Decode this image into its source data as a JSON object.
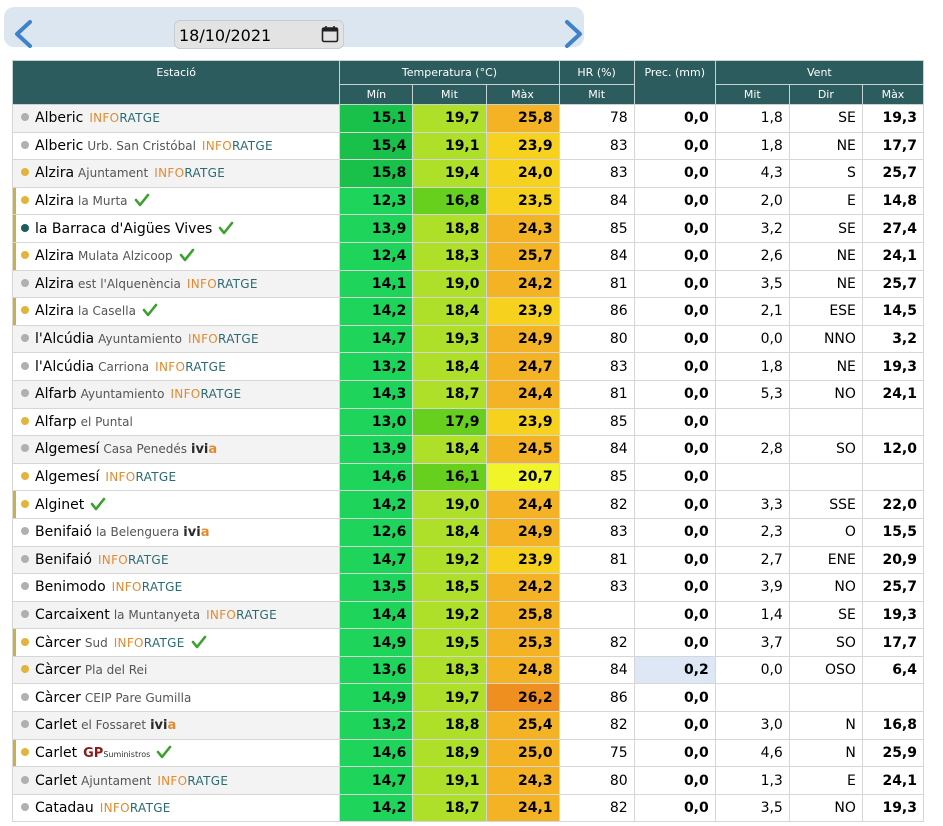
{
  "date": "18/10/2021",
  "headers": {
    "station": "Estació",
    "temperature": "Temperatura (°C)",
    "hr": "HR (%)",
    "prec": "Prec. (mm)",
    "wind": "Vent",
    "min": "Mín",
    "mit": "Mit",
    "max": "Màx",
    "hr_mit": "Mit",
    "wind_mit": "Mit",
    "wind_dir": "Dir",
    "wind_max": "Màx"
  },
  "colors": {
    "header_bg": "#2c5c5e",
    "dot_grey": "#b0b0b0",
    "dot_orange": "#e2b43a",
    "dot_teal": "#1e5b5e",
    "check_green": "#3aa12c",
    "prec_highlight": "#dde7f5"
  },
  "icons": {
    "prev": "chevron-left-icon",
    "next": "chevron-right-icon",
    "calendar": "calendar-icon",
    "validated": "check-icon"
  },
  "rows": [
    {
      "name": "Alberic",
      "sub": "",
      "brand": "inforatge",
      "check": false,
      "dot": "grey",
      "min": "15,1",
      "mit": "19,7",
      "max": "25,8",
      "hr": "78",
      "prec": "0,0",
      "wmit": "1,8",
      "wdir": "SE",
      "wmax": "19,3",
      "cmin": "#19c14a",
      "cmit": "#aee02a",
      "cmax": "#f3b324"
    },
    {
      "name": "Alberic",
      "sub": "Urb. San Cristóbal",
      "brand": "inforatge",
      "check": false,
      "dot": "grey",
      "min": "15,4",
      "mit": "19,1",
      "max": "23,9",
      "hr": "83",
      "prec": "0,0",
      "wmit": "1,8",
      "wdir": "NE",
      "wmax": "17,7",
      "cmin": "#19c14a",
      "cmit": "#aee02a",
      "cmax": "#f6d21f"
    },
    {
      "name": "Alzira",
      "sub": "Ajuntament",
      "brand": "inforatge",
      "check": false,
      "dot": "orange",
      "min": "15,8",
      "mit": "19,4",
      "max": "24,0",
      "hr": "83",
      "prec": "0,0",
      "wmit": "4,3",
      "wdir": "S",
      "wmax": "25,7",
      "cmin": "#19c14a",
      "cmit": "#aee02a",
      "cmax": "#f6d21f"
    },
    {
      "name": "Alzira",
      "sub": "la Murta",
      "brand": "",
      "check": true,
      "dot": "orange",
      "min": "12,3",
      "mit": "16,8",
      "max": "23,5",
      "hr": "84",
      "prec": "0,0",
      "wmit": "2,0",
      "wdir": "E",
      "wmax": "14,8",
      "cmin": "#1ed45a",
      "cmit": "#67cf1d",
      "cmax": "#f6d21f"
    },
    {
      "name": "la Barraca d'Aigües Vives",
      "sub": "",
      "brand": "",
      "check": true,
      "dot": "teal",
      "min": "13,9",
      "mit": "18,8",
      "max": "24,3",
      "hr": "85",
      "prec": "0,0",
      "wmit": "3,2",
      "wdir": "SE",
      "wmax": "27,4",
      "cmin": "#1ed45a",
      "cmit": "#aee02a",
      "cmax": "#f3b324"
    },
    {
      "name": "Alzira",
      "sub": "Mulata Alzicoop",
      "brand": "",
      "check": true,
      "dot": "orange",
      "min": "12,4",
      "mit": "18,3",
      "max": "25,7",
      "hr": "84",
      "prec": "0,0",
      "wmit": "2,6",
      "wdir": "NE",
      "wmax": "24,1",
      "cmin": "#1ed45a",
      "cmit": "#aee02a",
      "cmax": "#f3b324"
    },
    {
      "name": "Alzira",
      "sub": "est l'Alquenència",
      "brand": "inforatge",
      "check": false,
      "dot": "grey",
      "min": "14,1",
      "mit": "19,0",
      "max": "24,2",
      "hr": "81",
      "prec": "0,0",
      "wmit": "3,5",
      "wdir": "NE",
      "wmax": "25,7",
      "cmin": "#1ed45a",
      "cmit": "#aee02a",
      "cmax": "#f3b324"
    },
    {
      "name": "Alzira",
      "sub": "la Casella",
      "brand": "",
      "check": true,
      "dot": "orange",
      "min": "14,2",
      "mit": "18,4",
      "max": "23,9",
      "hr": "86",
      "prec": "0,0",
      "wmit": "2,1",
      "wdir": "ESE",
      "wmax": "14,5",
      "cmin": "#1ed45a",
      "cmit": "#aee02a",
      "cmax": "#f6d21f"
    },
    {
      "name": "l'Alcúdia",
      "sub": "Ayuntamiento",
      "brand": "inforatge",
      "check": false,
      "dot": "grey",
      "min": "14,7",
      "mit": "19,3",
      "max": "24,9",
      "hr": "80",
      "prec": "0,0",
      "wmit": "0,0",
      "wdir": "NNO",
      "wmax": "3,2",
      "cmin": "#1ed45a",
      "cmit": "#aee02a",
      "cmax": "#f3b324"
    },
    {
      "name": "l'Alcúdia",
      "sub": "Carriona",
      "brand": "inforatge",
      "check": false,
      "dot": "grey",
      "min": "13,2",
      "mit": "18,4",
      "max": "24,7",
      "hr": "83",
      "prec": "0,0",
      "wmit": "1,8",
      "wdir": "NE",
      "wmax": "19,3",
      "cmin": "#1ed45a",
      "cmit": "#aee02a",
      "cmax": "#f3b324"
    },
    {
      "name": "Alfarb",
      "sub": "Ayuntamiento",
      "brand": "inforatge",
      "check": false,
      "dot": "grey",
      "min": "14,3",
      "mit": "18,7",
      "max": "24,4",
      "hr": "81",
      "prec": "0,0",
      "wmit": "5,3",
      "wdir": "NO",
      "wmax": "24,1",
      "cmin": "#1ed45a",
      "cmit": "#aee02a",
      "cmax": "#f3b324"
    },
    {
      "name": "Alfarp",
      "sub": "el Puntal",
      "brand": "",
      "check": false,
      "dot": "orange",
      "min": "13,0",
      "mit": "17,9",
      "max": "23,9",
      "hr": "85",
      "prec": "0,0",
      "wmit": "",
      "wdir": "",
      "wmax": "",
      "cmin": "#1ed45a",
      "cmit": "#67cf1d",
      "cmax": "#f6d21f"
    },
    {
      "name": "Algemesí",
      "sub": "Casa Penedés",
      "brand": "ivia",
      "check": false,
      "dot": "grey",
      "min": "13,9",
      "mit": "18,4",
      "max": "24,5",
      "hr": "84",
      "prec": "0,0",
      "wmit": "2,8",
      "wdir": "SO",
      "wmax": "12,0",
      "cmin": "#1ed45a",
      "cmit": "#aee02a",
      "cmax": "#f3b324"
    },
    {
      "name": "Algemesí",
      "sub": "",
      "brand": "inforatge",
      "check": false,
      "dot": "orange",
      "min": "14,6",
      "mit": "16,1",
      "max": "20,7",
      "hr": "85",
      "prec": "0,0",
      "wmit": "",
      "wdir": "",
      "wmax": "",
      "cmin": "#1ed45a",
      "cmit": "#67cf1d",
      "cmax": "#f0f52a"
    },
    {
      "name": "Alginet",
      "sub": "",
      "brand": "",
      "check": true,
      "dot": "orange",
      "min": "14,2",
      "mit": "19,0",
      "max": "24,4",
      "hr": "82",
      "prec": "0,0",
      "wmit": "3,3",
      "wdir": "SSE",
      "wmax": "22,0",
      "cmin": "#1ed45a",
      "cmit": "#aee02a",
      "cmax": "#f3b324"
    },
    {
      "name": "Benifaió",
      "sub": "la Belenguera",
      "brand": "ivia",
      "check": false,
      "dot": "grey",
      "min": "12,6",
      "mit": "18,4",
      "max": "24,9",
      "hr": "83",
      "prec": "0,0",
      "wmit": "2,3",
      "wdir": "O",
      "wmax": "15,5",
      "cmin": "#1ed45a",
      "cmit": "#aee02a",
      "cmax": "#f3b324"
    },
    {
      "name": "Benifaió",
      "sub": "",
      "brand": "inforatge",
      "check": false,
      "dot": "grey",
      "min": "14,7",
      "mit": "19,2",
      "max": "23,9",
      "hr": "81",
      "prec": "0,0",
      "wmit": "2,7",
      "wdir": "ENE",
      "wmax": "20,9",
      "cmin": "#1ed45a",
      "cmit": "#aee02a",
      "cmax": "#f6d21f"
    },
    {
      "name": "Benimodo",
      "sub": "",
      "brand": "inforatge",
      "check": false,
      "dot": "grey",
      "min": "13,5",
      "mit": "18,5",
      "max": "24,2",
      "hr": "83",
      "prec": "0,0",
      "wmit": "3,9",
      "wdir": "NO",
      "wmax": "25,7",
      "cmin": "#1ed45a",
      "cmit": "#aee02a",
      "cmax": "#f3b324"
    },
    {
      "name": "Carcaixent",
      "sub": "la Muntanyeta",
      "brand": "inforatge",
      "check": false,
      "dot": "grey",
      "min": "14,4",
      "mit": "19,2",
      "max": "25,8",
      "hr": "",
      "prec": "0,0",
      "wmit": "1,4",
      "wdir": "SE",
      "wmax": "19,3",
      "cmin": "#1ed45a",
      "cmit": "#aee02a",
      "cmax": "#f3b324"
    },
    {
      "name": "Càrcer",
      "sub": "Sud",
      "brand": "inforatge",
      "check": true,
      "dot": "orange",
      "min": "14,9",
      "mit": "19,5",
      "max": "25,3",
      "hr": "82",
      "prec": "0,0",
      "wmit": "3,7",
      "wdir": "SO",
      "wmax": "17,7",
      "cmin": "#1ed45a",
      "cmit": "#aee02a",
      "cmax": "#f3b324"
    },
    {
      "name": "Càrcer",
      "sub": "Pla del Rei",
      "brand": "",
      "check": false,
      "dot": "orange",
      "min": "13,6",
      "mit": "18,3",
      "max": "24,8",
      "hr": "84",
      "prec": "0,2",
      "wmit": "0,0",
      "wdir": "OSO",
      "wmax": "6,4",
      "cmin": "#1ed45a",
      "cmit": "#aee02a",
      "cmax": "#f3b324"
    },
    {
      "name": "Càrcer",
      "sub": "CEIP Pare Gumilla",
      "brand": "",
      "check": false,
      "dot": "grey",
      "min": "14,9",
      "mit": "19,7",
      "max": "26,2",
      "hr": "86",
      "prec": "0,0",
      "wmit": "",
      "wdir": "",
      "wmax": "",
      "cmin": "#1ed45a",
      "cmit": "#aee02a",
      "cmax": "#ef8f1f"
    },
    {
      "name": "Carlet",
      "sub": "el Fossaret",
      "brand": "ivia",
      "check": false,
      "dot": "grey",
      "min": "13,2",
      "mit": "18,8",
      "max": "25,4",
      "hr": "82",
      "prec": "0,0",
      "wmit": "3,0",
      "wdir": "N",
      "wmax": "16,8",
      "cmin": "#1ed45a",
      "cmit": "#aee02a",
      "cmax": "#f3b324"
    },
    {
      "name": "Carlet",
      "sub": "",
      "brand": "gp",
      "check": true,
      "dot": "orange",
      "min": "14,6",
      "mit": "18,9",
      "max": "25,0",
      "hr": "75",
      "prec": "0,0",
      "wmit": "4,6",
      "wdir": "N",
      "wmax": "25,9",
      "cmin": "#1ed45a",
      "cmit": "#aee02a",
      "cmax": "#f3b324"
    },
    {
      "name": "Carlet",
      "sub": "Ajuntament",
      "brand": "inforatge",
      "check": false,
      "dot": "grey",
      "min": "14,7",
      "mit": "19,1",
      "max": "24,3",
      "hr": "80",
      "prec": "0,0",
      "wmit": "1,3",
      "wdir": "E",
      "wmax": "24,1",
      "cmin": "#1ed45a",
      "cmit": "#aee02a",
      "cmax": "#f3b324"
    },
    {
      "name": "Catadau",
      "sub": "",
      "brand": "inforatge",
      "check": false,
      "dot": "grey",
      "min": "14,2",
      "mit": "18,7",
      "max": "24,1",
      "hr": "82",
      "prec": "0,0",
      "wmit": "3,5",
      "wdir": "NO",
      "wmax": "19,3",
      "cmin": "#1ed45a",
      "cmit": "#aee02a",
      "cmax": "#f3b324"
    }
  ],
  "brands": {
    "inforatge_a": "INFO",
    "inforatge_b": "RATGE",
    "ivia_a": "ivi",
    "ivia_b": "a",
    "gp": "GP",
    "gp_small": "Suministros"
  }
}
